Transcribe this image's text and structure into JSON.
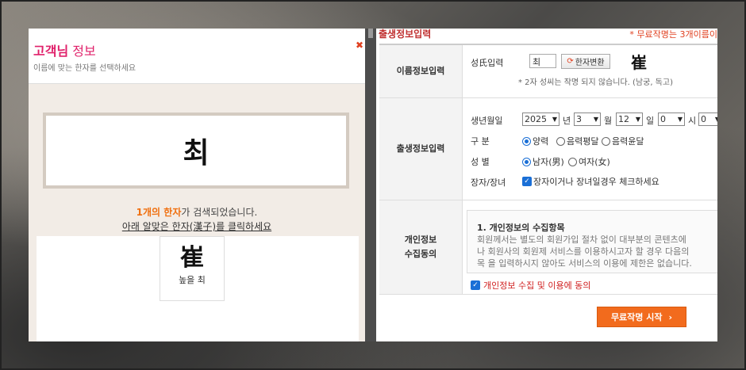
{
  "popup": {
    "title_bold": "고객님",
    "title_rest": " 정보",
    "subtitle": "이름에 맞는 한자를 선택하세요",
    "close": "✖",
    "name": "최",
    "result_hl": "1개의 한자",
    "result_rest": "가 검색되었습니다.",
    "click_instruction": "아래 알맞은 한자(漢子)를 클릭하세요",
    "hanja_options": [
      {
        "hanja": "崔",
        "meaning": "높을 최"
      }
    ]
  },
  "form": {
    "title": "출생정보입력",
    "note": "* 무료작명는 3개이름이",
    "name_section": {
      "label": "이름정보입력",
      "surname_label": "성氏입력",
      "surname_value": "최",
      "convert_button": "한자변환",
      "selected_hanja": "崔",
      "note": "* 2자 성씨는 작명 되지 않습니다. (남궁, 독고)"
    },
    "birth_section": {
      "label": "출생정보입력",
      "date_label": "생년월일",
      "year": "2025",
      "year_unit": "년",
      "month": "3",
      "month_unit": "월",
      "day": "12",
      "day_unit": "일",
      "hour": "0",
      "hour_unit": "시",
      "minute": "0",
      "type_label": "구 분",
      "type_options": [
        "양력",
        "음력평달",
        "음력윤달"
      ],
      "type_selected": "양력",
      "gender_label": "성 별",
      "gender_options": [
        "남자(男)",
        "여자(女)"
      ],
      "gender_selected": "남자(男)",
      "eldest_label": "장자/장녀",
      "eldest_check_label": "장자이거나 장녀일경우 체크하세요",
      "eldest_checked": true
    },
    "privacy_section": {
      "label_line1": "개인정보",
      "label_line2": "수집동의",
      "box_title": "1. 개인정보의 수집항목",
      "box_line1": "회원께서는 별도의 회원가입 절차 없이 대부분의 콘텐츠에",
      "box_line2": "나 회원사의 회원제 서비스를 이용하시고자 할 경우 다음의",
      "box_line3": "목 을 입력하시지 않아도 서비스의 이용에 제한은 없습니다.",
      "agree_label": "개인정보 수집 및 이용에 동의",
      "agree_checked": true
    },
    "start_button": "무료작명 시작",
    "start_arrow": "›"
  },
  "colors": {
    "accent_pink": "#e0206a",
    "accent_orange": "#f26b1d",
    "radio_blue": "#1a6fd6"
  }
}
